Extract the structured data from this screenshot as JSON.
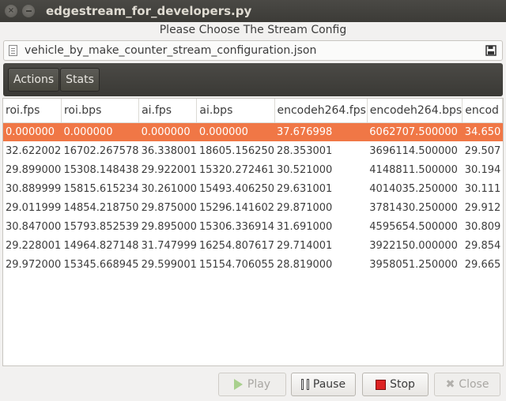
{
  "window": {
    "title": "edgestream_for_developers.py",
    "subtitle": "Please Choose The Stream Config"
  },
  "config_file": {
    "name": "vehicle_by_make_counter_stream_configuration.json"
  },
  "toolbar": {
    "actions_label": "Actions",
    "stats_label": "Stats"
  },
  "table": {
    "headers": [
      "roi.fps",
      "roi.bps",
      "ai.fps",
      "ai.bps",
      "encodeh264.fps",
      "encodeh264.bps",
      "encod"
    ],
    "selected_row": 0,
    "rows": [
      [
        "0.000000",
        "0.000000",
        "0.000000",
        "0.000000",
        "37.676998",
        "6062707.500000",
        "34.650"
      ],
      [
        "32.622002",
        "16702.267578",
        "36.338001",
        "18605.156250",
        "28.353001",
        "3696114.500000",
        "29.507"
      ],
      [
        "29.899000",
        "15308.148438",
        "29.922001",
        "15320.272461",
        "30.521000",
        "4148811.500000",
        "30.194"
      ],
      [
        "30.889999",
        "15815.615234",
        "30.261000",
        "15493.406250",
        "29.631001",
        "4014035.250000",
        "30.111"
      ],
      [
        "29.011999",
        "14854.218750",
        "29.875000",
        "15296.141602",
        "29.871000",
        "3781430.250000",
        "29.912"
      ],
      [
        "30.847000",
        "15793.852539",
        "29.895000",
        "15306.336914",
        "31.691000",
        "4595654.500000",
        "30.809"
      ],
      [
        "29.228001",
        "14964.827148",
        "31.747999",
        "16254.807617",
        "29.714001",
        "3922150.000000",
        "29.854"
      ],
      [
        "29.972000",
        "15345.668945",
        "29.599001",
        "15154.706055",
        "28.819000",
        "3958051.250000",
        "29.665"
      ]
    ]
  },
  "buttons": {
    "play": "Play",
    "pause": "Pause",
    "stop": "Stop",
    "close": "Close"
  },
  "colors": {
    "selection": "#f07746",
    "titlebar": "#3c3b37"
  }
}
